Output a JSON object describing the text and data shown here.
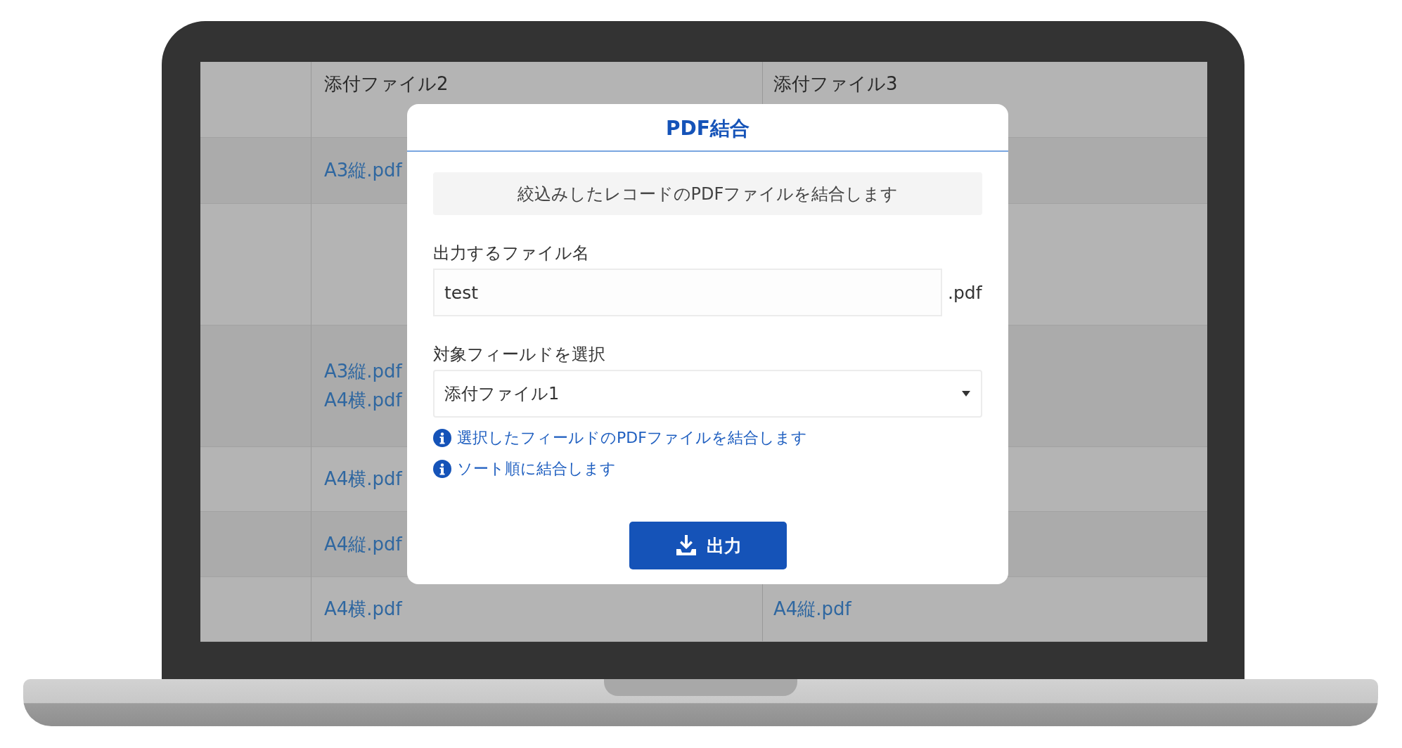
{
  "table": {
    "columns": [
      {
        "label": "添付ファイル2"
      },
      {
        "label": "添付ファイル3"
      }
    ],
    "rows": [
      {
        "attachment_2": [
          "A3縦.pdf"
        ]
      },
      {},
      {
        "attachment_2": [
          "A3縦.pdf",
          "A4横.pdf"
        ]
      },
      {
        "attachment_2": [
          "A4横.pdf"
        ]
      },
      {
        "attachment_2": [
          "A4縦.pdf"
        ]
      },
      {
        "attachment_2": [
          "A4横.pdf"
        ],
        "attachment_3": [
          "A4縦.pdf"
        ]
      }
    ]
  },
  "dialog": {
    "title": "PDF結合",
    "notice": "絞込みしたレコードのPDFファイルを結合します",
    "filename": {
      "label": "出力するファイル名",
      "value": "test",
      "suffix": ".pdf"
    },
    "field_select": {
      "label": "対象フィールドを選択",
      "value": "添付ファイル1"
    },
    "notes": [
      "選択したフィールドのPDFファイルを結合します",
      "ソート順に結合します"
    ],
    "button": "出力"
  }
}
